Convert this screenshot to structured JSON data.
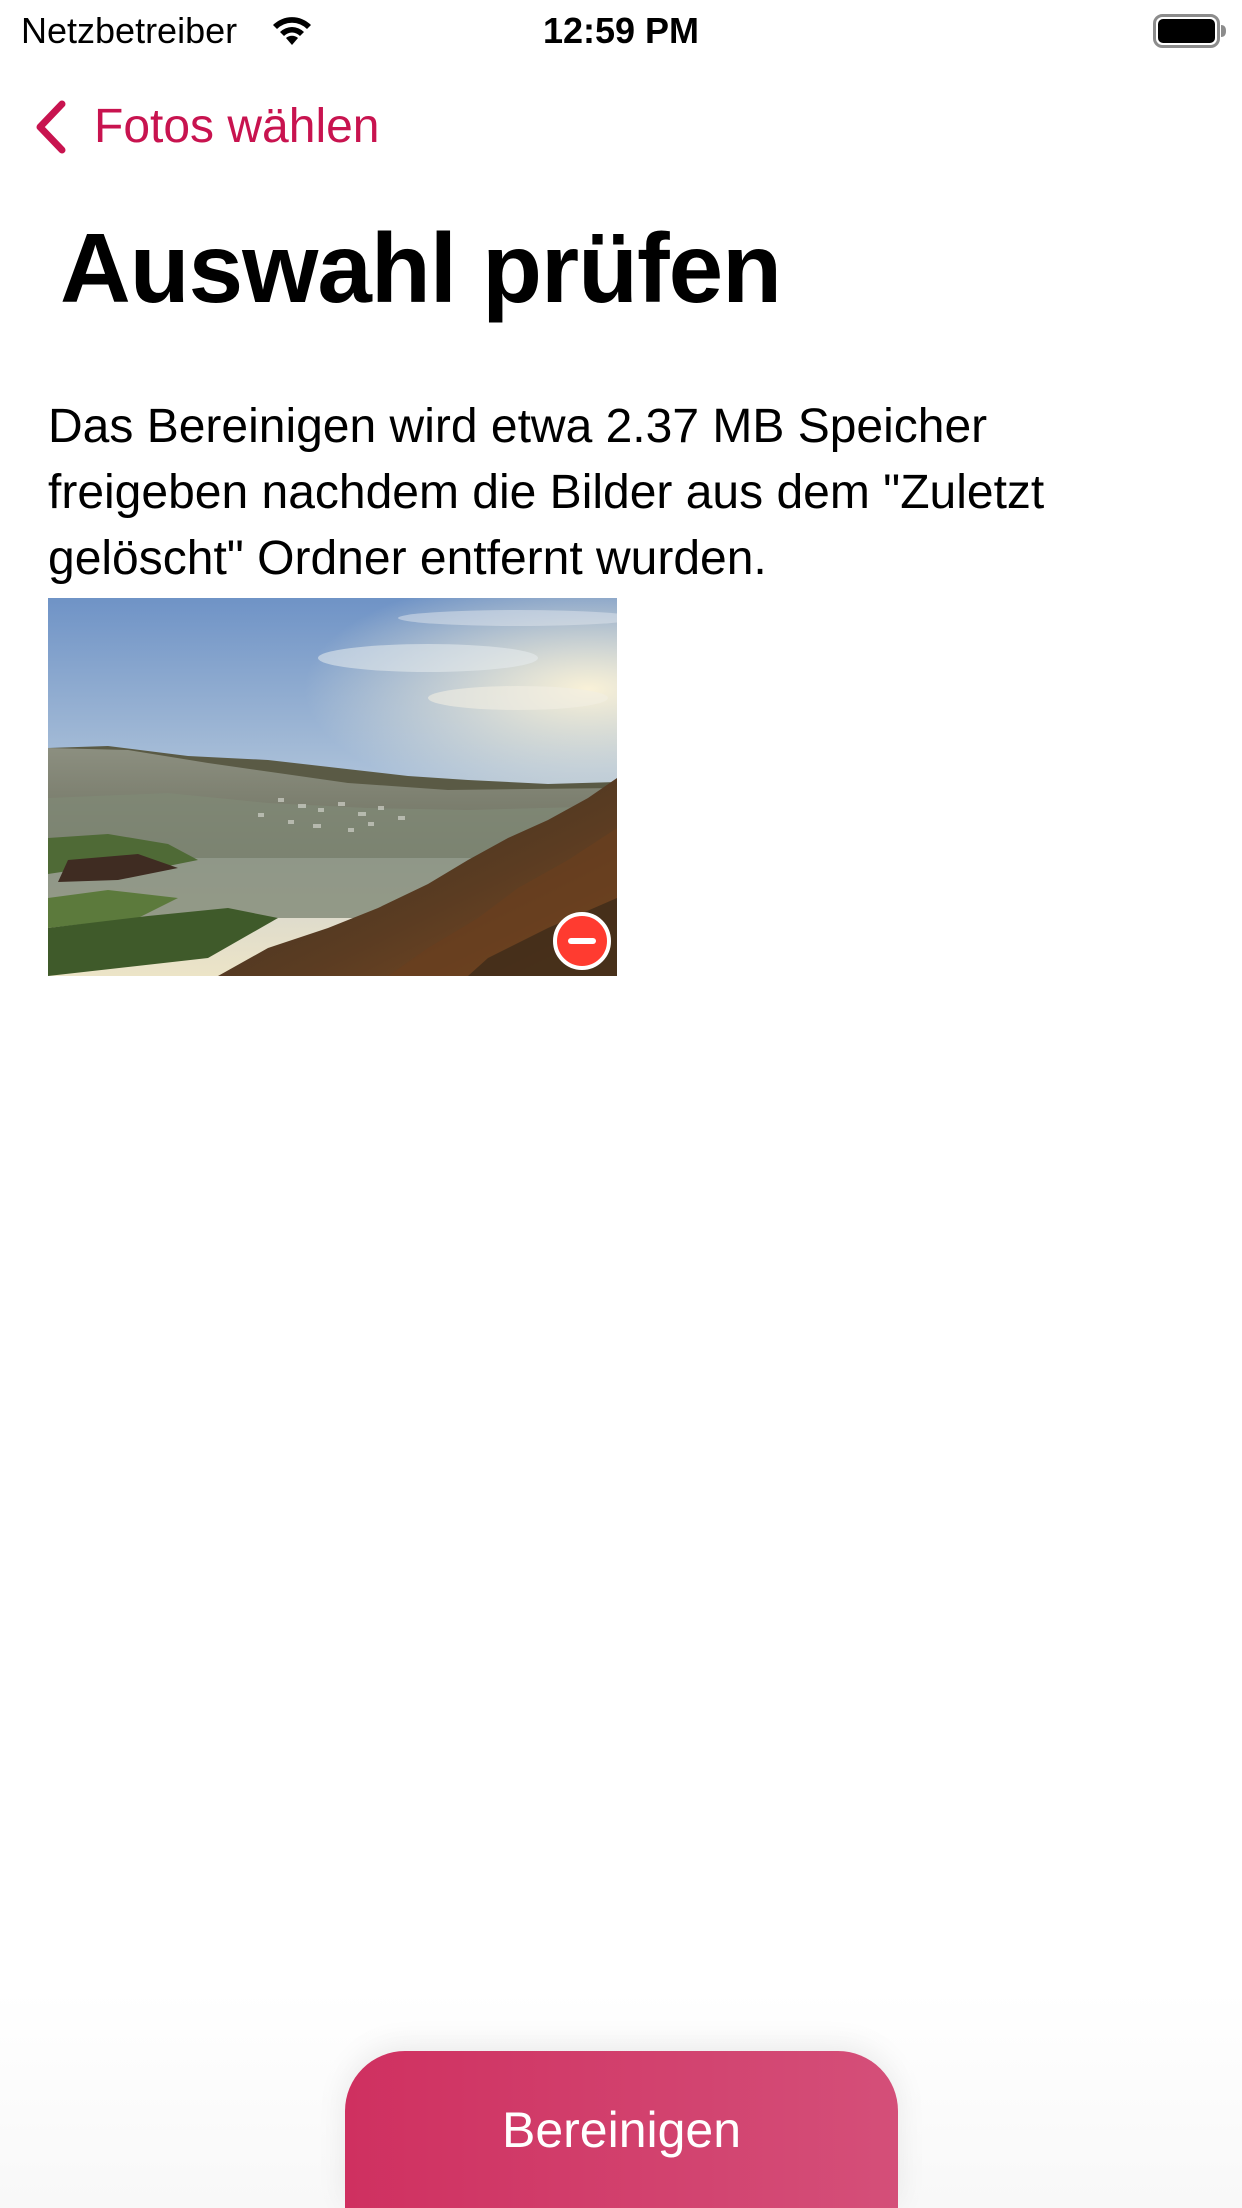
{
  "status_bar": {
    "carrier": "Netzbetreiber",
    "time": "12:59 PM",
    "wifi_icon": "wifi-icon",
    "battery_icon": "battery-icon"
  },
  "nav": {
    "back_label": "Fotos wählen",
    "back_icon": "chevron-left-icon"
  },
  "page": {
    "title": "Auswahl prüfen",
    "description": "Das Bereinigen wird etwa 2.37 MB Speicher freigeben nachdem die Bilder aus dem \"Zuletzt gelöscht\" Ordner entfernt wurden."
  },
  "photos": [
    {
      "remove_icon": "minus-circle-icon"
    }
  ],
  "actions": {
    "clean_label": "Bereinigen"
  },
  "colors": {
    "accent": "#c8134f",
    "button_start": "#cf3060",
    "button_end": "#d44f79",
    "remove": "#ff3b30"
  }
}
